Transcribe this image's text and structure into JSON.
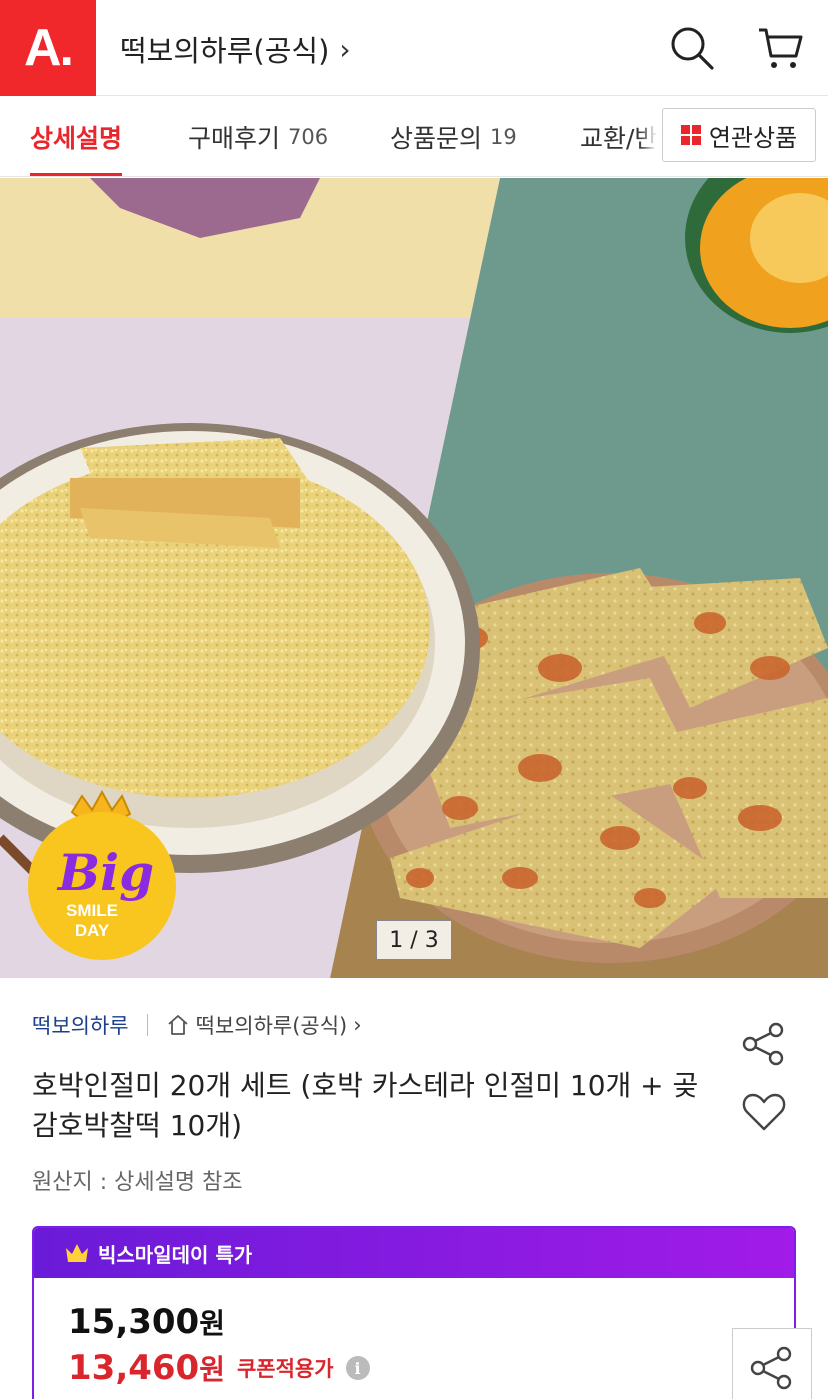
{
  "header": {
    "logo": "A.",
    "store_title": "떡보의하루(공식)",
    "chevron": "›"
  },
  "tabs": [
    {
      "label": "상세설명",
      "count": ""
    },
    {
      "label": "구매후기",
      "count": "706"
    },
    {
      "label": "상품문의",
      "count": "19"
    },
    {
      "label": "교환/반",
      "count": ""
    }
  ],
  "related_button": {
    "label": "연관상품"
  },
  "gallery": {
    "indicator": "1 / 3"
  },
  "badge": {
    "line1": "Big",
    "line2": "SMILE",
    "line3": "DAY"
  },
  "product": {
    "seller": "떡보의하루",
    "store_link": "떡보의하루(공식)",
    "title": "호박인절미 20개 세트 (호박 카스테라 인절미 10개 + 곶감호박찰떡 10개)",
    "origin": "원산지 : 상세설명 참조"
  },
  "price": {
    "event_label": "빅스마일데이 특가",
    "original_amount": "15,300",
    "sale_amount": "13,460",
    "currency": "원",
    "coupon_label": "쿠폰적용가",
    "info_glyph": "i"
  },
  "colors": {
    "brand": "#f0272b",
    "active_tab": "#e8262b",
    "event_gradient_start": "#6a1bd8",
    "event_gradient_end": "#a21be8",
    "sale_price": "#d9262c",
    "seller_link": "#1b3f8b"
  }
}
